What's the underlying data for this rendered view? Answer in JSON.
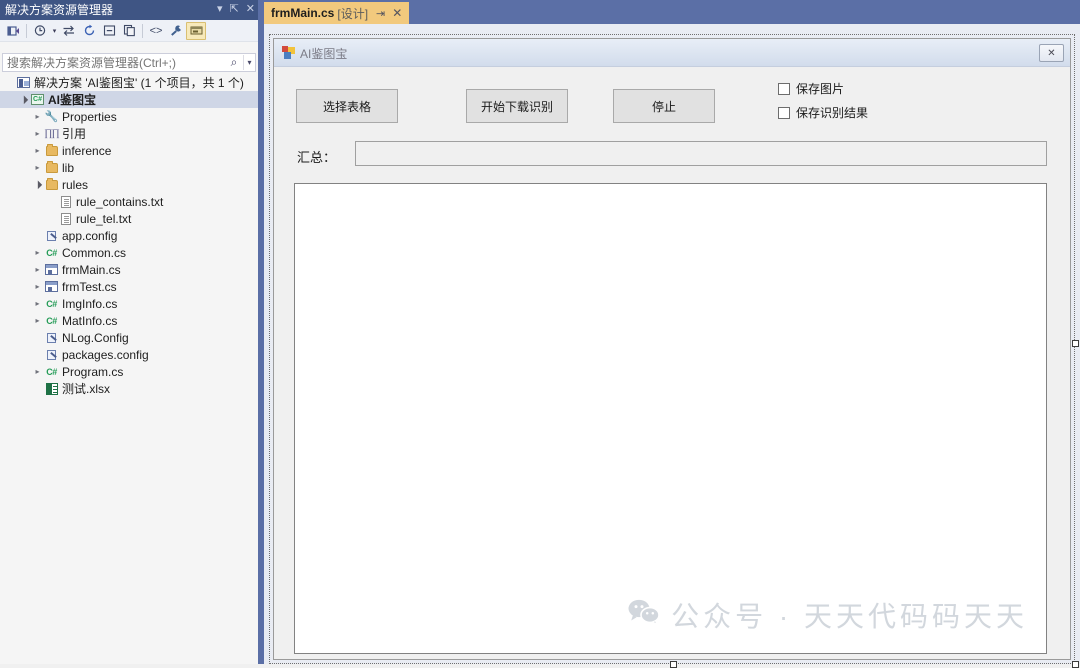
{
  "solution_explorer": {
    "title": "解决方案资源管理器",
    "title_buttons": [
      {
        "name": "dropdown",
        "glyph": "▾"
      },
      {
        "name": "pin",
        "glyph": "⇱"
      },
      {
        "name": "close",
        "glyph": "✕"
      }
    ],
    "toolbar": [
      {
        "name": "home-icon",
        "tip": "主页"
      },
      {
        "name": "pending-changes-icon",
        "tip": "挂起的更改筛选器"
      },
      {
        "name": "sync-icon",
        "tip": "与活动文档同步"
      },
      {
        "name": "refresh-icon",
        "tip": "刷新"
      },
      {
        "name": "collapse-all-icon",
        "tip": "全部折叠"
      },
      {
        "name": "show-all-files-icon",
        "tip": "显示所有文件"
      },
      {
        "name": "view-code-icon",
        "tip": "查看代码"
      },
      {
        "name": "properties-icon",
        "tip": "属性"
      },
      {
        "name": "view-designer-icon",
        "tip": "视图设计器"
      }
    ],
    "search": {
      "placeholder": "搜索解决方案资源管理器(Ctrl+;)",
      "value": "",
      "magnifier": "⌕",
      "dropdown": "▾"
    },
    "tree": [
      {
        "label": "解决方案 'AI鉴图宝' (1 个项目，共 1 个)",
        "icon": "solution-icon",
        "indent": 0,
        "arrow": "",
        "selected": false,
        "bold": false
      },
      {
        "label": "AI鉴图宝",
        "icon": "project-icon",
        "indent": 1,
        "arrow": "▲",
        "selected": true,
        "bold": true
      },
      {
        "label": "Properties",
        "icon": "wrench-icon",
        "indent": 2,
        "arrow": "▷",
        "selected": false,
        "bold": false
      },
      {
        "label": "引用",
        "icon": "references-icon",
        "indent": 2,
        "arrow": "▷",
        "selected": false,
        "bold": false
      },
      {
        "label": "inference",
        "icon": "folder-icon",
        "indent": 2,
        "arrow": "▷",
        "selected": false,
        "bold": false
      },
      {
        "label": "lib",
        "icon": "folder-icon",
        "indent": 2,
        "arrow": "▷",
        "selected": false,
        "bold": false
      },
      {
        "label": "rules",
        "icon": "folder-icon",
        "indent": 2,
        "arrow": "▲",
        "selected": false,
        "bold": false
      },
      {
        "label": "rule_contains.txt",
        "icon": "text-file-icon",
        "indent": 3,
        "arrow": "",
        "selected": false,
        "bold": false
      },
      {
        "label": "rule_tel.txt",
        "icon": "text-file-icon",
        "indent": 3,
        "arrow": "",
        "selected": false,
        "bold": false
      },
      {
        "label": "app.config",
        "icon": "config-file-icon",
        "indent": 2,
        "arrow": "",
        "selected": false,
        "bold": false
      },
      {
        "label": "Common.cs",
        "icon": "csharp-file-icon",
        "indent": 2,
        "arrow": "▷",
        "selected": false,
        "bold": false
      },
      {
        "label": "frmMain.cs",
        "icon": "winform-file-icon",
        "indent": 2,
        "arrow": "▷",
        "selected": false,
        "bold": false
      },
      {
        "label": "frmTest.cs",
        "icon": "winform-file-icon",
        "indent": 2,
        "arrow": "▷",
        "selected": false,
        "bold": false
      },
      {
        "label": "ImgInfo.cs",
        "icon": "csharp-file-icon",
        "indent": 2,
        "arrow": "▷",
        "selected": false,
        "bold": false
      },
      {
        "label": "MatInfo.cs",
        "icon": "csharp-file-icon",
        "indent": 2,
        "arrow": "▷",
        "selected": false,
        "bold": false
      },
      {
        "label": "NLog.Config",
        "icon": "config-file-icon",
        "indent": 2,
        "arrow": "",
        "selected": false,
        "bold": false
      },
      {
        "label": "packages.config",
        "icon": "config-file-icon",
        "indent": 2,
        "arrow": "",
        "selected": false,
        "bold": false
      },
      {
        "label": "Program.cs",
        "icon": "csharp-file-icon",
        "indent": 2,
        "arrow": "▷",
        "selected": false,
        "bold": false
      },
      {
        "label": "测试.xlsx",
        "icon": "excel-file-icon",
        "indent": 2,
        "arrow": "",
        "selected": false,
        "bold": false
      }
    ]
  },
  "editor": {
    "tab": {
      "name": "frmMain.cs",
      "mode": "[设计]",
      "pin_glyph": "⇥",
      "close_glyph": "✕"
    }
  },
  "designer": {
    "form": {
      "title": "AI鉴图宝",
      "close_glyph": "✕"
    },
    "buttons": [
      {
        "label": "选择表格",
        "name": "select-table-button"
      },
      {
        "label": "开始下载识别",
        "name": "start-download-recognize-button"
      },
      {
        "label": "停止",
        "name": "stop-button"
      }
    ],
    "checkboxes": [
      {
        "label": "保存图片",
        "checked": false,
        "name": "save-image-checkbox"
      },
      {
        "label": "保存识别结果",
        "checked": false,
        "name": "save-result-checkbox"
      }
    ],
    "summary": {
      "label": "汇总：",
      "value": ""
    },
    "watermark": {
      "icon": "wechat-icon",
      "text": "公众号 · 天天代码码天天"
    }
  },
  "colors": {
    "title_bar": "#3f5584",
    "tab_strip": "#5b6fa6",
    "active_tab": "#f2c97d",
    "selection": "#cfd6e6",
    "form_chrome": "#f0f0f0",
    "watermark": "#d2d7dd"
  }
}
